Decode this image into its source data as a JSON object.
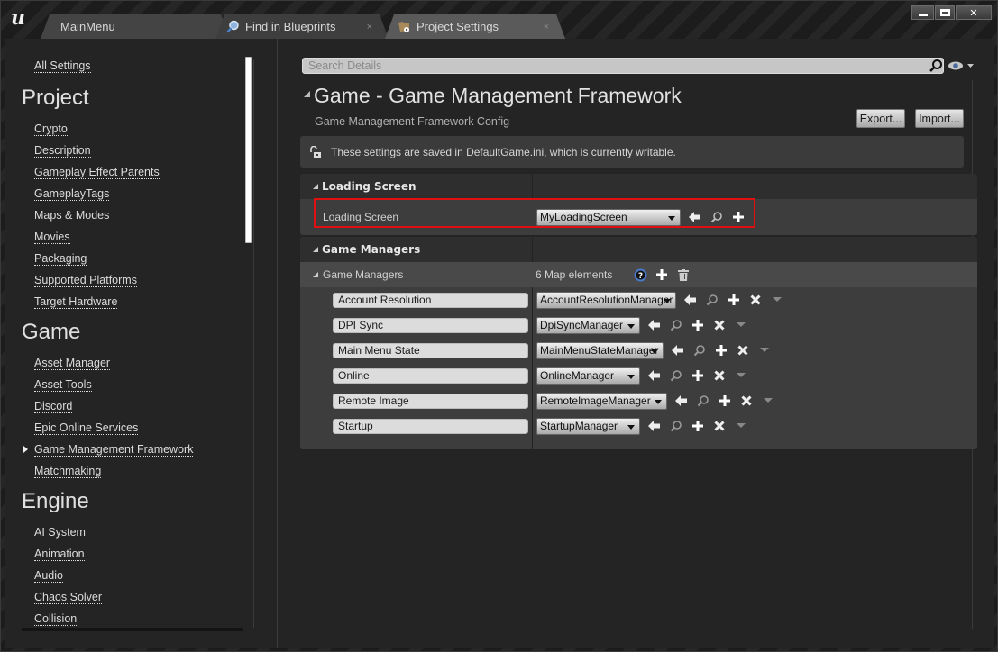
{
  "window": {
    "tabs": [
      {
        "label": "MainMenu",
        "icon": "none",
        "active": false
      },
      {
        "label": "Find in Blueprints",
        "icon": "magnifier-icon",
        "close": "×",
        "active": false
      },
      {
        "label": "Project Settings",
        "icon": "project-settings-icon",
        "close": "×",
        "active": true
      }
    ],
    "controls": {
      "minimize": "minimize",
      "maximize": "maximize",
      "close": "✕"
    }
  },
  "sidebar": {
    "all_settings": "All Settings",
    "sections": [
      {
        "heading": "Project",
        "items": [
          "Crypto",
          "Description",
          "Gameplay Effect Parents",
          "GameplayTags",
          "Maps & Modes",
          "Movies",
          "Packaging",
          "Supported Platforms",
          "Target Hardware"
        ]
      },
      {
        "heading": "Game",
        "items": [
          "Asset Manager",
          "Asset Tools",
          "Discord",
          "Epic Online Services",
          "Game Management Framework",
          "Matchmaking"
        ],
        "selected": "Game Management Framework"
      },
      {
        "heading": "Engine",
        "items": [
          "AI System",
          "Animation",
          "Audio",
          "Chaos Solver",
          "Collision"
        ]
      }
    ]
  },
  "details": {
    "search_placeholder": "Search Details",
    "title": "Game - Game Management Framework",
    "subtitle": "Game Management Framework Config",
    "export_label": "Export...",
    "import_label": "Import...",
    "notice": "These settings are saved in DefaultGame.ini, which is currently writable.",
    "loading_screen_category": {
      "header": "Loading Screen",
      "property_label": "Loading Screen",
      "value": "MyLoadingScreen"
    },
    "game_managers_category": {
      "header": "Game Managers",
      "property_label": "Game Managers",
      "count_text": "6 Map elements",
      "entries": [
        {
          "key": "Account Resolution",
          "value": "AccountResolutionManager"
        },
        {
          "key": "DPI Sync",
          "value": "DpiSyncManager"
        },
        {
          "key": "Main Menu State",
          "value": "MainMenuStateManager"
        },
        {
          "key": "Online",
          "value": "OnlineManager"
        },
        {
          "key": "Remote Image",
          "value": "RemoteImageManager"
        },
        {
          "key": "Startup",
          "value": "StartupManager"
        }
      ]
    },
    "highlight_color": "#e01010"
  }
}
